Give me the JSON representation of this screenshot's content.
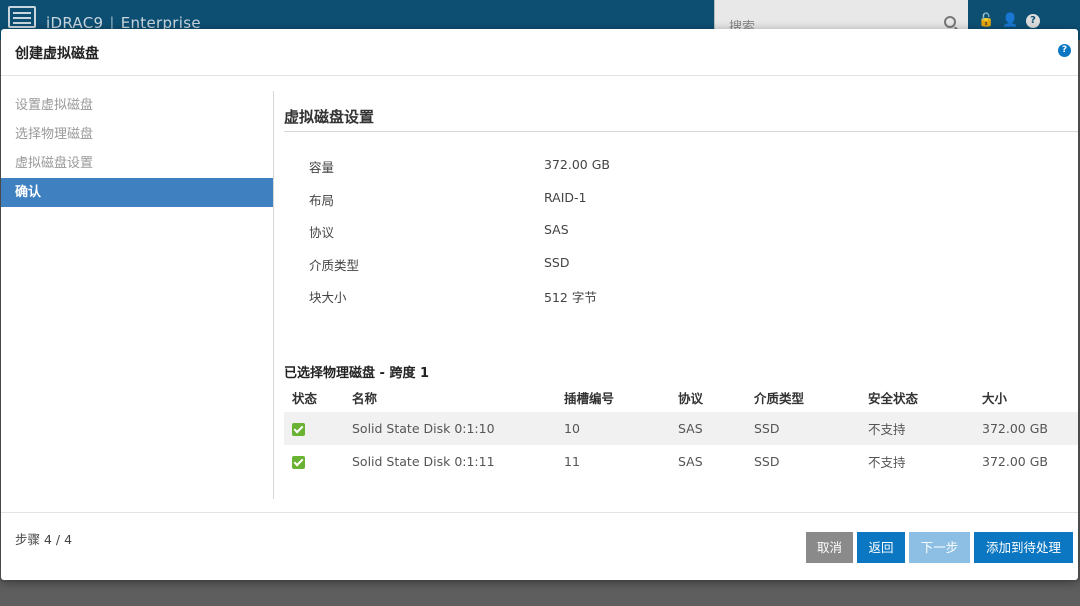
{
  "app": {
    "title": "iDRAC9",
    "edition": "Enterprise",
    "search_placeholder": "搜索"
  },
  "modal": {
    "title": "创建虚拟磁盘",
    "help": "?"
  },
  "sidebar": {
    "items": [
      {
        "label": "设置虚拟磁盘",
        "active": false
      },
      {
        "label": "选择物理磁盘",
        "active": false
      },
      {
        "label": "虚拟磁盘设置",
        "active": false
      },
      {
        "label": "确认",
        "active": true
      }
    ]
  },
  "settings": {
    "title": "虚拟磁盘设置",
    "rows": [
      {
        "label": "容量",
        "value": "372.00 GB"
      },
      {
        "label": "布局",
        "value": "RAID-1"
      },
      {
        "label": "协议",
        "value": "SAS"
      },
      {
        "label": "介质类型",
        "value": "SSD"
      },
      {
        "label": "块大小",
        "value": "512 字节"
      }
    ]
  },
  "physical_disks": {
    "title": "已选择物理磁盘 - 跨度 1",
    "headers": [
      "状态",
      "名称",
      "插槽编号",
      "协议",
      "介质类型",
      "安全状态",
      "大小"
    ],
    "rows": [
      {
        "name": "Solid State Disk 0:1:10",
        "slot": "10",
        "protocol": "SAS",
        "media": "SSD",
        "security": "不支持",
        "size": "372.00 GB"
      },
      {
        "name": "Solid State Disk 0:1:11",
        "slot": "11",
        "protocol": "SAS",
        "media": "SSD",
        "security": "不支持",
        "size": "372.00 GB"
      }
    ]
  },
  "footer": {
    "step": "步骤 4 / 4",
    "cancel": "取消",
    "back": "返回",
    "next": "下一步",
    "add": "添加到待处理"
  },
  "colors": {
    "header_bg": "#0d4f73",
    "active_item": "#3f80c0",
    "primary_button": "#0b77c2",
    "status_ok": "#6ab233"
  }
}
